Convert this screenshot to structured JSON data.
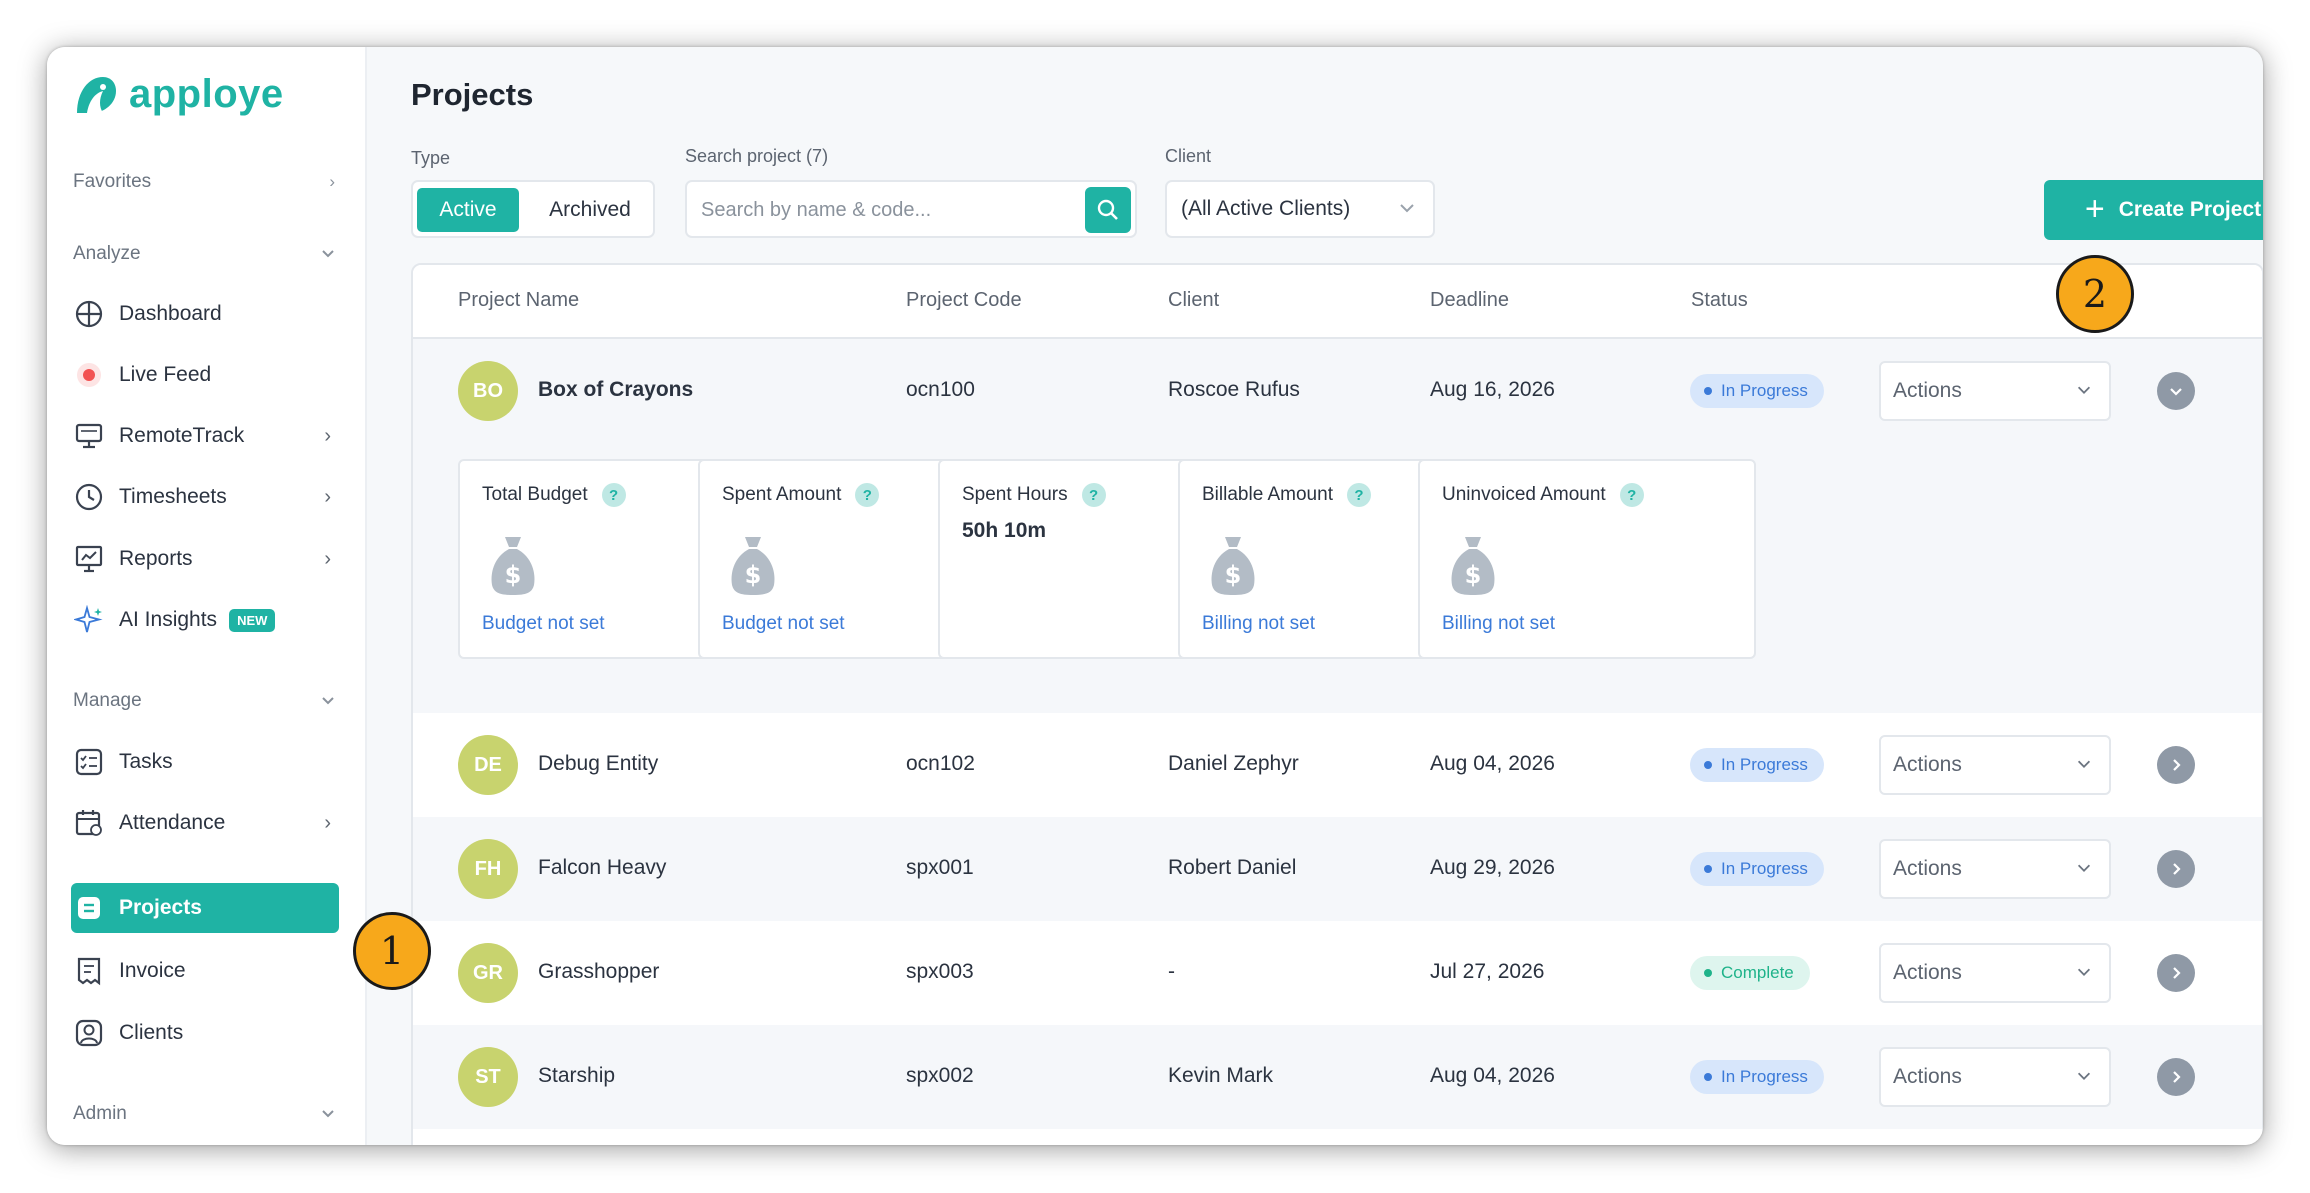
{
  "app": {
    "name": "apploye"
  },
  "colors": {
    "accent": "#1fb3a4",
    "avatar": "#c8d36e",
    "in_progress": "#3b7ad8",
    "complete": "#1fb38a",
    "callout": "#f7a81b"
  },
  "sidebar": {
    "favorites": "Favorites",
    "analyze": "Analyze",
    "manage": "Manage",
    "admin": "Admin",
    "items": [
      {
        "label": "Dashboard",
        "icon": "dashboard-icon"
      },
      {
        "label": "Live Feed",
        "icon": "live-dot-icon"
      },
      {
        "label": "RemoteTrack",
        "icon": "monitor-icon"
      },
      {
        "label": "Timesheets",
        "icon": "clock-icon"
      },
      {
        "label": "Reports",
        "icon": "reports-icon"
      },
      {
        "label": "AI Insights",
        "icon": "sparkle-icon",
        "badge": "NEW"
      },
      {
        "label": "Tasks",
        "icon": "tasks-icon"
      },
      {
        "label": "Attendance",
        "icon": "calendar-icon"
      },
      {
        "label": "Projects",
        "icon": "projects-icon"
      },
      {
        "label": "Invoice",
        "icon": "invoice-icon"
      },
      {
        "label": "Clients",
        "icon": "clients-icon"
      }
    ]
  },
  "page": {
    "title": "Projects",
    "type_label": "Type",
    "type_active": "Active",
    "type_archived": "Archived",
    "search_label": "Search project (7)",
    "search_placeholder": "Search by name & code...",
    "client_label": "Client",
    "client_value": "(All Active Clients)",
    "create_label": "Create Project"
  },
  "table": {
    "headers": [
      "Project Name",
      "Project Code",
      "Client",
      "Deadline",
      "Status"
    ],
    "rows": [
      {
        "initials": "BO",
        "name": "Box of Crayons",
        "code": "ocn100",
        "client": "Roscoe Rufus",
        "deadline": "Aug 16, 2026",
        "status": "In Progress",
        "actions": "Actions"
      },
      {
        "initials": "DE",
        "name": "Debug Entity",
        "code": "ocn102",
        "client": "Daniel Zephyr",
        "deadline": "Aug 04, 2026",
        "status": "In Progress",
        "actions": "Actions"
      },
      {
        "initials": "FH",
        "name": "Falcon Heavy",
        "code": "spx001",
        "client": "Robert Daniel",
        "deadline": "Aug 29, 2026",
        "status": "In Progress",
        "actions": "Actions"
      },
      {
        "initials": "GR",
        "name": "Grasshopper",
        "code": "spx003",
        "client": "-",
        "deadline": "Jul 27, 2026",
        "status": "Complete",
        "actions": "Actions"
      },
      {
        "initials": "ST",
        "name": "Starship",
        "code": "spx002",
        "client": "Kevin Mark",
        "deadline": "Aug 04, 2026",
        "status": "In Progress",
        "actions": "Actions"
      }
    ],
    "details": [
      {
        "title": "Total Budget",
        "link": "Budget not set"
      },
      {
        "title": "Spent Amount",
        "link": "Budget not set"
      },
      {
        "title": "Spent Hours",
        "value": "50h 10m"
      },
      {
        "title": "Billable Amount",
        "link": "Billing not set"
      },
      {
        "title": "Uninvoiced Amount",
        "link": "Billing not set"
      }
    ],
    "help": "?"
  },
  "callouts": [
    "1",
    "2"
  ]
}
